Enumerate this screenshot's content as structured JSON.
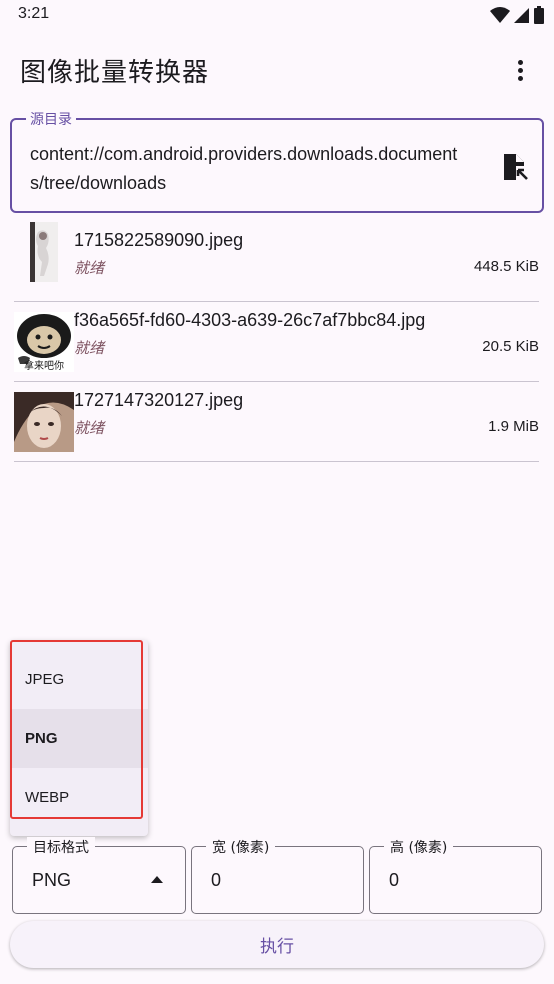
{
  "status_bar": {
    "time": "3:21"
  },
  "app_bar": {
    "title": "图像批量转换器",
    "menu_icon": "more-vert-icon"
  },
  "source": {
    "label": "源目录",
    "value": "content://com.android.providers.downloads.documents/tree/downloads",
    "action_icon": "file-open-icon"
  },
  "files": [
    {
      "name": "1715822589090.jpeg",
      "status": "就绪",
      "size": "448.5 KiB"
    },
    {
      "name": "f36a565f-fd60-4303-a639-26c7af7bbc84.jpg",
      "status": "就绪",
      "size": "20.5 KiB",
      "thumb_caption": "拿来吧你"
    },
    {
      "name": "1727147320127.jpeg",
      "status": "就绪",
      "size": "1.9 MiB"
    }
  ],
  "format_menu": {
    "options": [
      "JPEG",
      "PNG",
      "WEBP"
    ],
    "selected": "PNG",
    "highlight_color": "#e53935"
  },
  "output": {
    "format_label": "目标格式",
    "format_value": "PNG",
    "width_label": "宽 (像素)",
    "width_value": "0",
    "height_label": "高 (像素)",
    "height_value": "0"
  },
  "execute_button": {
    "label": "执行"
  },
  "colors": {
    "accent": "#6750a4",
    "status_text": "#7d5260",
    "background": "#fdf8fd"
  }
}
